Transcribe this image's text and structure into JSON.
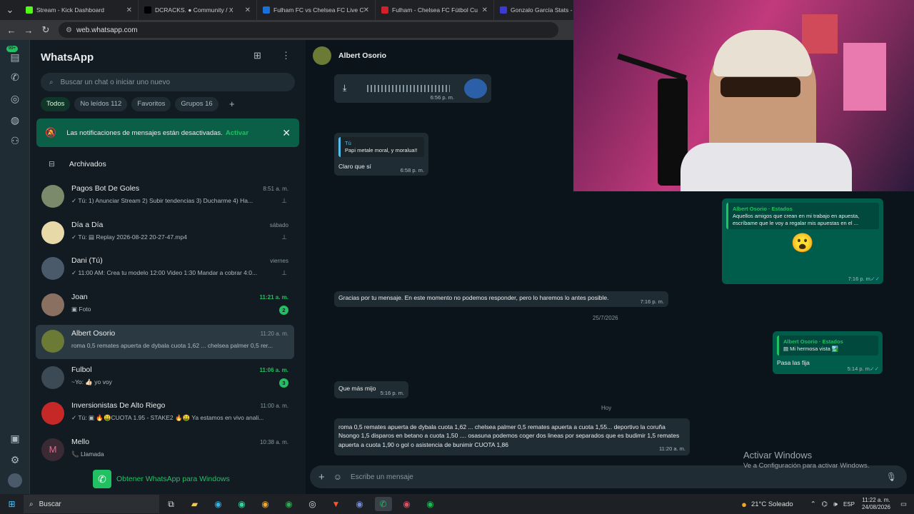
{
  "browser": {
    "tabs": [
      {
        "title": "Stream - Kick Dashboard",
        "color": "#53fc18"
      },
      {
        "title": "DCRACKS. ● Community / X",
        "color": "#000000"
      },
      {
        "title": "Fulham FC vs Chelsea FC Live C",
        "color": "#1b6fd8"
      },
      {
        "title": "Fulham - Chelsea FC Fútbol Cu",
        "color": "#d4202a"
      },
      {
        "title": "Gonzalo García Stats - xG, Shot",
        "color": "#3b3bcf"
      }
    ],
    "url": "web.whatsapp.com"
  },
  "sidebar": {
    "app_title": "WhatsApp",
    "status_badge": "99+",
    "search_placeholder": "Buscar un chat o iniciar uno nuevo",
    "filters": [
      {
        "label": "Todos",
        "active": true
      },
      {
        "label": "No leídos 112",
        "active": false
      },
      {
        "label": "Favoritos",
        "active": false
      },
      {
        "label": "Grupos 16",
        "active": false
      }
    ],
    "notification": {
      "text": "Las notificaciones de mensajes están desactivadas.",
      "action": "Activar"
    },
    "archived_label": "Archivados",
    "chats": [
      {
        "name": "Pagos Bot De Goles",
        "time": "8:51 a. m.",
        "preview": "✓ Tú: 1) Anunciar Stream 2) Subir tendencias 3) Ducharme 4) Ha...",
        "pinned": true,
        "time_green": false,
        "unread": "",
        "avatar_color": "#7b8a6a"
      },
      {
        "name": "Día a Día",
        "time": "sábado",
        "preview": "✓ Tú: ▤ Replay 2026-08-22 20-27-47.mp4",
        "pinned": true,
        "time_green": false,
        "unread": "",
        "avatar_color": "#e8d9a8"
      },
      {
        "name": "Dani (Tú)",
        "time": "viernes",
        "preview": "✓ 11:00 AM: Crea tu modelo  12:00 Video 1:30 Mandar a cobrar 4:0...",
        "pinned": true,
        "time_green": false,
        "unread": "",
        "avatar_color": "#4a5a6a"
      },
      {
        "name": "Joan",
        "time": "11:21 a. m.",
        "preview": "▣ Foto",
        "pinned": false,
        "time_green": true,
        "unread": "2",
        "avatar_color": "#8a7060"
      },
      {
        "name": "Albert Osorio",
        "time": "11:20 a. m.",
        "preview": "roma 0,5 remates apuerta de dybala cuota 1,62 ... chelsea palmer 0,5 rer...",
        "pinned": false,
        "time_green": false,
        "unread": "",
        "avatar_color": "#6b7a34",
        "selected": true
      },
      {
        "name": "Fulbol",
        "time": "11:06 a. m.",
        "preview": "~Yo: 👍🏻 yo voy",
        "pinned": false,
        "time_green": true,
        "unread": "3",
        "avatar_color": "#3b4a54"
      },
      {
        "name": "Inversionistas De Alto Riego",
        "time": "11:00 a. m.",
        "preview": "✓ Tú: ▣ 🔥🤑CUOTA 1.95 - STAKE2 🔥🤑 Ya estamos en vivo anali...",
        "pinned": false,
        "time_green": false,
        "unread": "",
        "avatar_color": "#c62828"
      },
      {
        "name": "Mello",
        "time": "10:38 a. m.",
        "preview": "📞 Llamada",
        "pinned": false,
        "time_green": false,
        "unread": "",
        "avatar_color": "#3b2a34",
        "initial": "M"
      }
    ],
    "get_app": "Obtener WhatsApp para Windows"
  },
  "conversation": {
    "contact": "Albert Osorio",
    "voice_time": "6:56 p. m.",
    "reply1": {
      "author": "Tú",
      "quote": "Papi metale moral, y moralua!!",
      "text": "Claro que sí",
      "time": "6:58 p. m."
    },
    "status_reply1": {
      "author": "Albert Osorio · Estados",
      "quote": "Aquellos amigos que crean en mi trabajo en apuesta, escríbame que le voy a regalar mis apuestas en el ...",
      "emoji": "😮",
      "time": "7:16 p. m."
    },
    "auto_reply": {
      "text": "Gracias por tu mensaje. En este momento no podemos responder, pero lo haremos lo antes posible.",
      "time": "7:16 p. m."
    },
    "date1": "25/7/2026",
    "status_reply2": {
      "author": "Albert Osorio · Estados",
      "quote": "▤ Mi hermosa vista 🏞️",
      "text": "Pasa las fija",
      "time": "5:14 p. m."
    },
    "msg_que": {
      "text": "Que más mijo",
      "time": "5:16 p. m."
    },
    "date2": "Hoy",
    "msg_long": {
      "text": "roma 0,5 remates apuerta de dybala cuota 1,62 ... chelsea palmer 0,5 remates apuerta a cuota 1,55... deportivo la coruña Nsongo 1,5 disparos en betano a cuota 1,50 .... osasuna podemos coger dos lineas por separados que es budimir 1,5 remates apuerta a cuota 1,90 o gol o asistencia de bunimir  CUOTA 1,86",
      "time": "11:20 a. m."
    },
    "composer_placeholder": "Escribe un mensaje"
  },
  "windows_watermark": {
    "title": "Activar Windows",
    "subtitle": "Ve a Configuración para activar Windows."
  },
  "taskbar": {
    "search": "Buscar",
    "weather": "21°C  Soleado",
    "lang": "ESP",
    "time": "11:22 a. m.",
    "date": "24/08/2026"
  }
}
